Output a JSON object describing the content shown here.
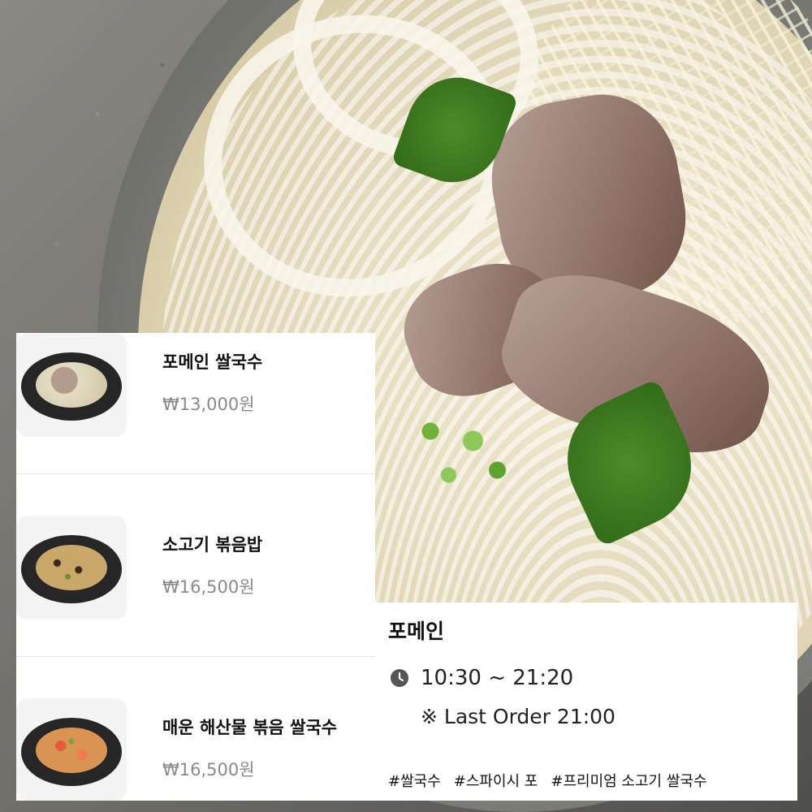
{
  "background": {
    "photo": "pho-rice-noodle-bowl-photo"
  },
  "menu": {
    "items": [
      {
        "name": "포메인 쌀국수",
        "price": "₩13,000원",
        "thumb_icon": "pho-noodle-bowl-image"
      },
      {
        "name": "소고기 볶음밥",
        "price": "₩16,500원",
        "thumb_icon": "beef-fried-rice-plate-image"
      },
      {
        "name": "매운 해산물 볶음 쌀국수",
        "price": "₩16,500원",
        "thumb_icon": "spicy-seafood-stirfry-noodle-image"
      }
    ]
  },
  "store": {
    "name": "포메인",
    "hours": "10:30 ~ 21:20",
    "last_order": "※ Last Order 21:00",
    "hours_icon": "clock-icon",
    "tags": [
      "#쌀국수",
      "#스파이시 포",
      "#프리미엄 소고기 쌀국수"
    ]
  },
  "colors": {
    "panel_bg": "#ffffff",
    "name_text": "#111111",
    "price_text": "#8a8a8a",
    "divider": "#e6e6e6",
    "icon": "#555555"
  }
}
